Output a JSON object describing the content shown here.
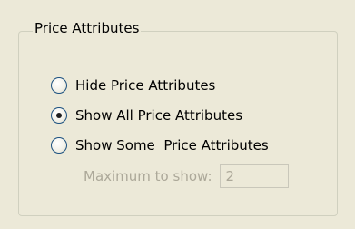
{
  "group": {
    "title": "Price Attributes"
  },
  "options": [
    {
      "label": "Hide Price Attributes",
      "checked": false
    },
    {
      "label": "Show All Price Attributes",
      "checked": true
    },
    {
      "label": "Show Some  Price Attributes",
      "checked": false
    }
  ],
  "max_to_show": {
    "label": "Maximum to show:",
    "value": "2",
    "disabled": true
  }
}
